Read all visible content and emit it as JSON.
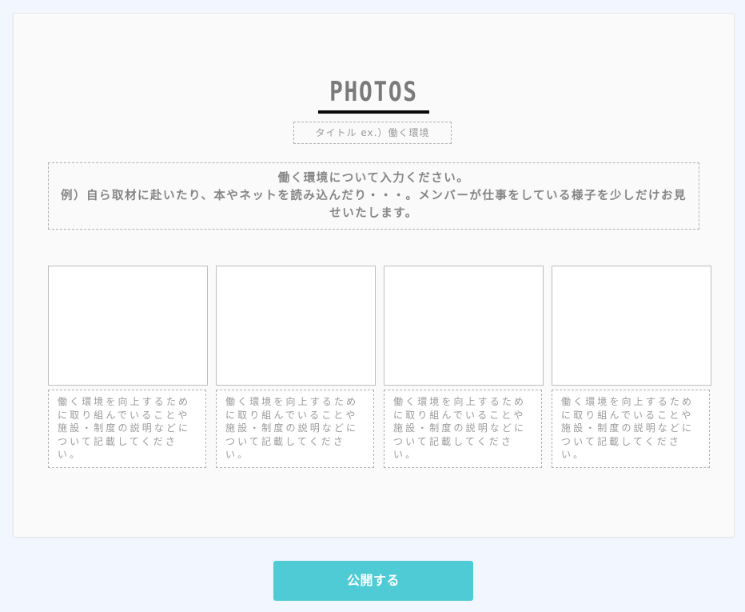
{
  "section": {
    "heading": "PHOTOS",
    "title_input_placeholder": "タイトル ex.）働く環境",
    "description_line1": "働く環境について入力ください。",
    "description_line2": "例）自ら取材に赴いたり、本やネットを読み込んだり・・・。メンバーが仕事をしている様子を少しだけお見せいたします。"
  },
  "photos": [
    {
      "caption": "働く環境を向上するために取り組んでいることや施設・制度の説明などについて記載してください。"
    },
    {
      "caption": "働く環境を向上するために取り組んでいることや施設・制度の説明などについて記載してください。"
    },
    {
      "caption": "働く環境を向上するために取り組んでいることや施設・制度の説明などについて記載してください。"
    },
    {
      "caption": "働く環境を向上するために取り組んでいることや施設・制度の説明などについて記載してください。"
    }
  ],
  "footer": {
    "publish_label": "公開する"
  },
  "colors": {
    "page_background": "#f2f6ff",
    "card_background": "#fafafa",
    "accent_button": "#4ecbd5",
    "heading_underline": "#0a0a0a"
  }
}
